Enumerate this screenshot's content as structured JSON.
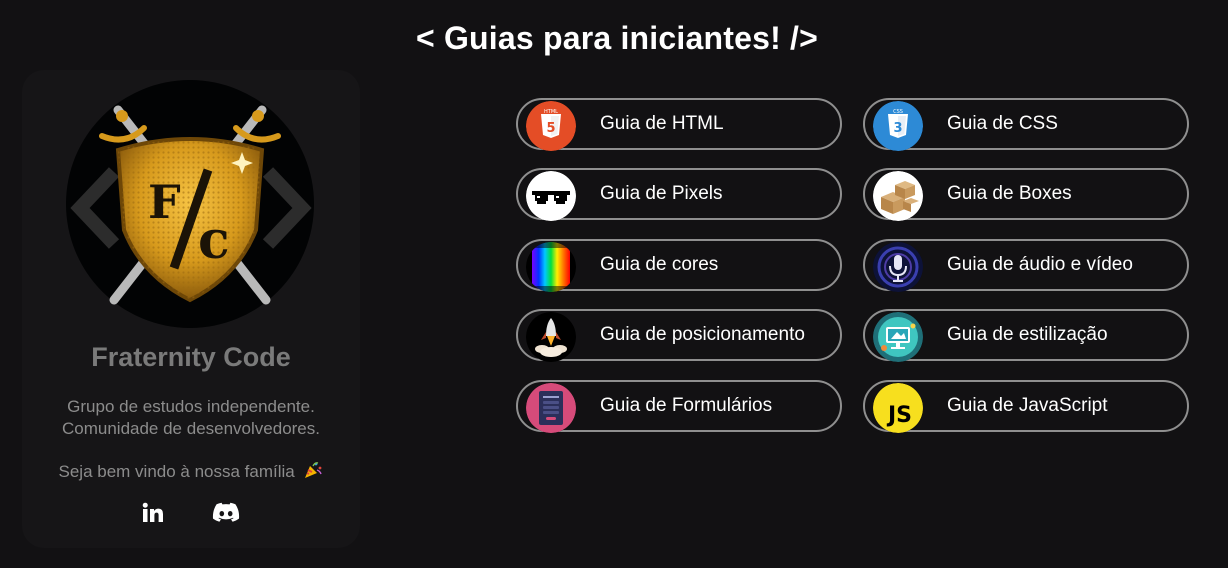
{
  "page": {
    "title": "< Guias para iniciantes! />"
  },
  "profile": {
    "logo_text": "F/c",
    "name": "Fraternity Code",
    "description_lines": [
      "Grupo de estudos independente.",
      "Comunidade de desenvolvedores."
    ],
    "welcome": "Seja bem vindo à nossa família",
    "social": {
      "linkedin_label": "in",
      "discord_label": "discord"
    }
  },
  "guides": [
    {
      "label": "Guia de HTML",
      "icon": "html5-icon",
      "color": "#e44d26"
    },
    {
      "label": "Guia de CSS",
      "icon": "css3-icon",
      "color": "#2965f1"
    },
    {
      "label": "Guia de Pixels",
      "icon": "pixel-glasses-icon",
      "color": "#ffffff"
    },
    {
      "label": "Guia de Boxes",
      "icon": "boxes-icon",
      "color": "#c8a06a"
    },
    {
      "label": "Guia de cores",
      "icon": "color-spectrum-icon",
      "color": "#ff0000"
    },
    {
      "label": "Guia de áudio e vídeo",
      "icon": "microphone-icon",
      "color": "#1a1f5c"
    },
    {
      "label": "Guia de posicionamento",
      "icon": "rocket-icon",
      "color": "#000000"
    },
    {
      "label": "Guia de estilização",
      "icon": "styling-monitor-icon",
      "color": "#2bbfbf"
    },
    {
      "label": "Guia de Formulários",
      "icon": "form-icon",
      "color": "#d64b7a"
    },
    {
      "label": "Guia de JavaScript",
      "icon": "javascript-icon",
      "color": "#f7df1e"
    }
  ]
}
